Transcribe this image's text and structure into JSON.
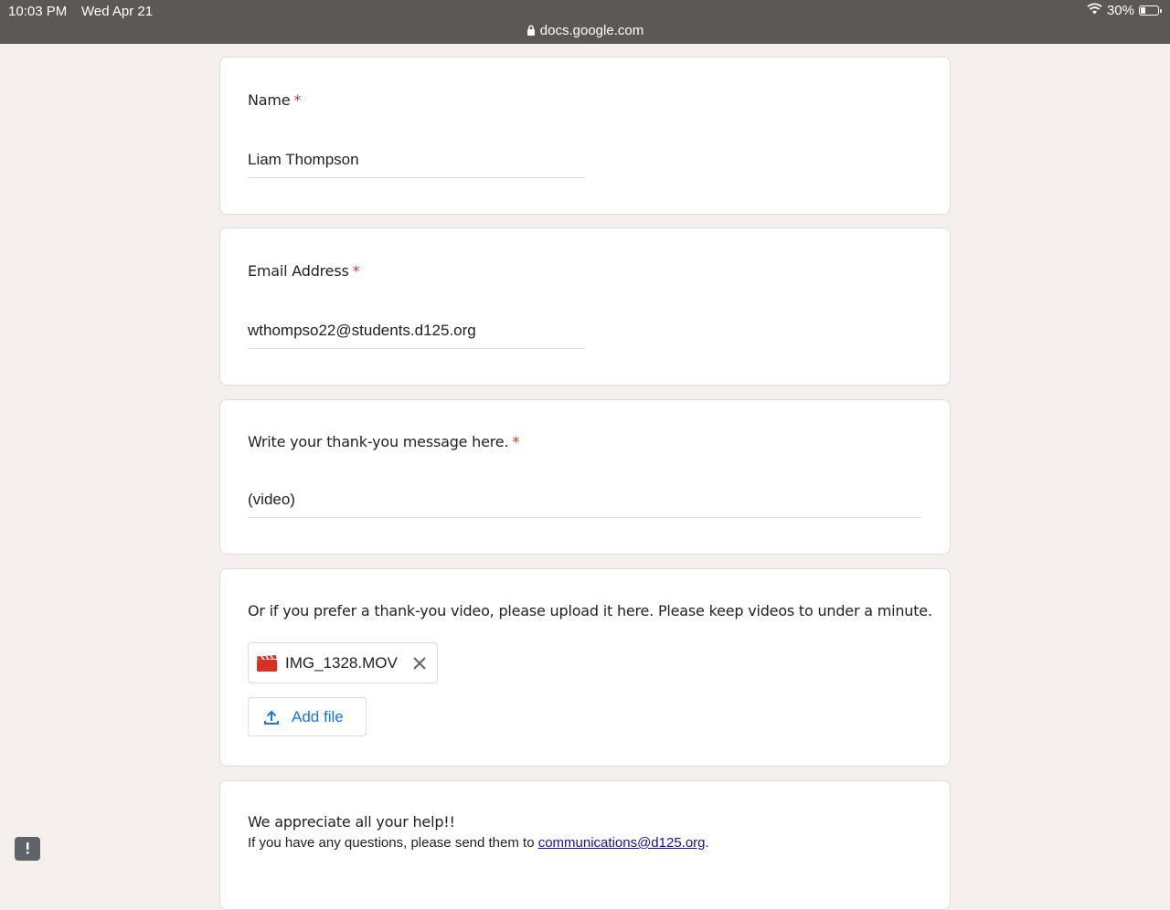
{
  "status_bar": {
    "time": "10:03 PM",
    "date": "Wed Apr 21",
    "battery": "30%",
    "battery_level": 0.3,
    "url": "docs.google.com"
  },
  "form": {
    "questions": [
      {
        "title": "Name",
        "required": "*",
        "answer": "Liam Thompson"
      },
      {
        "title": "Email Address",
        "required": "*",
        "answer": "wthompso22@students.d125.org"
      },
      {
        "title": "Write your thank-you message here.",
        "required": "*",
        "answer": "(video)"
      },
      {
        "title": "Or if you prefer a thank-you video, please upload it here. Please keep videos to under a minute.",
        "file_name": "IMG_1328.MOV",
        "add_file_label": "Add file"
      }
    ],
    "footer": {
      "title": "We appreciate all your help!!",
      "help_prefix": "If you have any questions, please send them to ",
      "email": "communications@d125.org",
      "help_suffix": "."
    }
  },
  "colors": {
    "background": "#f5efed",
    "status_bar": "#5b5857",
    "required": "#d93025",
    "accent": "#1a73e8",
    "file_icon": "#d93025"
  },
  "icons": [
    "lock-icon",
    "wifi-icon",
    "battery-icon",
    "video-file-icon",
    "close-icon",
    "upload-icon",
    "feedback-icon"
  ]
}
